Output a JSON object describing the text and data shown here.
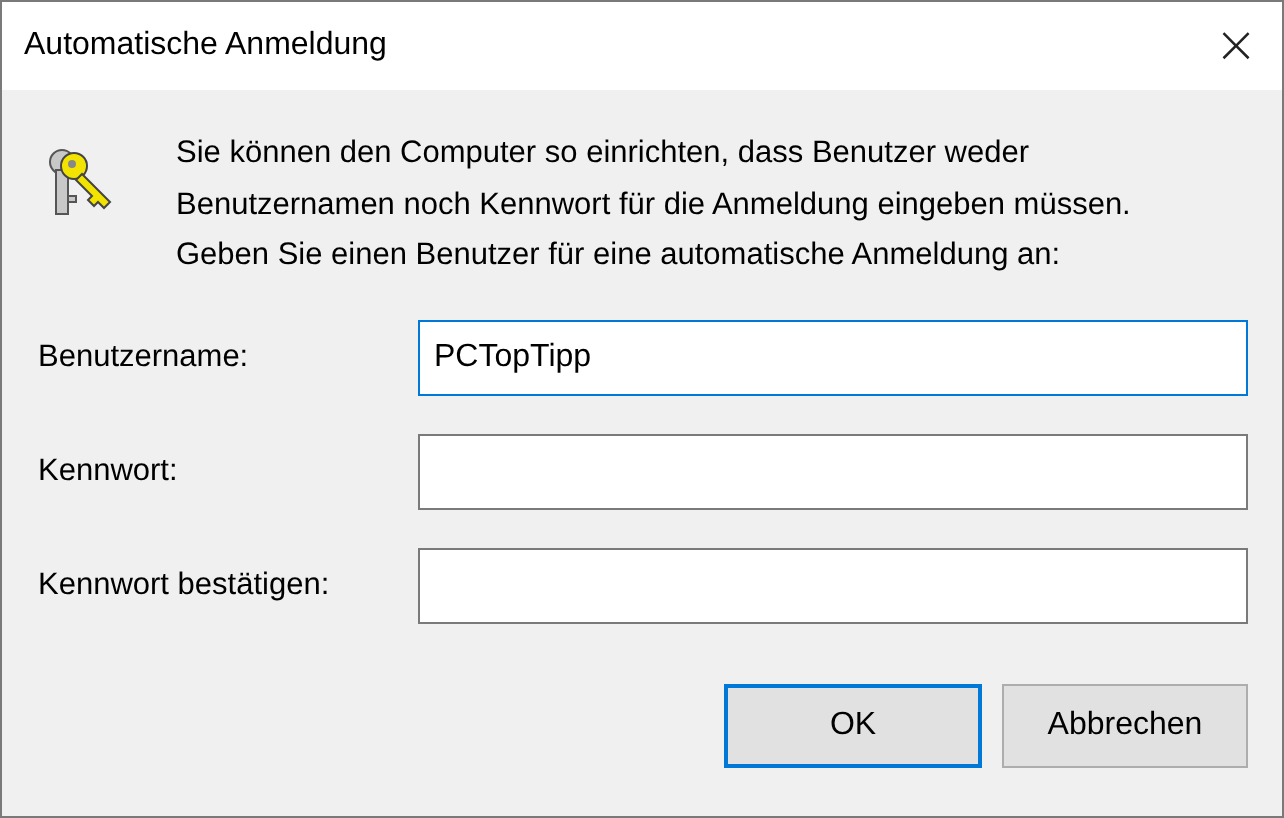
{
  "window": {
    "title": "Automatische Anmeldung",
    "close": "×"
  },
  "description": "Sie können den Computer so einrichten, dass Benutzer weder Benutzernamen noch Kennwort für die Anmeldung eingeben müssen. Geben Sie einen Benutzer für eine automatische Anmeldung an:",
  "fields": [
    {
      "label": "Benutzername:",
      "value": "PCTopTipp",
      "focused": true
    },
    {
      "label": "Kennwort:",
      "focused": false
    },
    {
      "label": "Kennwort bestätigen:",
      "focused": false
    }
  ],
  "buttons": [
    {
      "label": "OK",
      "default": true
    },
    {
      "label": "Abbrechen",
      "default": false
    }
  ]
}
